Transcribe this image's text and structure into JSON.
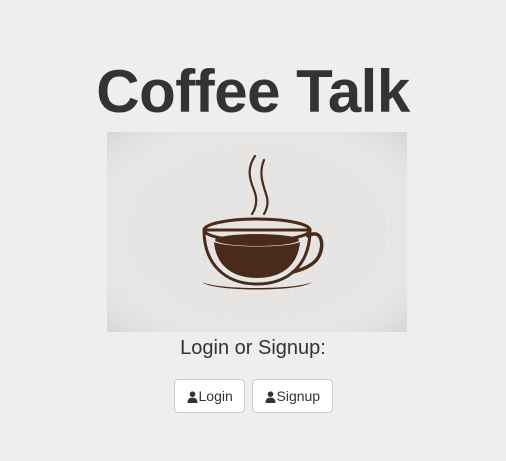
{
  "header": {
    "title": "Coffee Talk"
  },
  "logo": {
    "icon": "coffee-cup-icon",
    "paper_color": "#e6e5e3",
    "cup_color": "#4a2a1a"
  },
  "auth": {
    "prompt": "Login or Signup:",
    "login_label": "Login",
    "signup_label": "Signup",
    "button_icon": "user-icon"
  }
}
